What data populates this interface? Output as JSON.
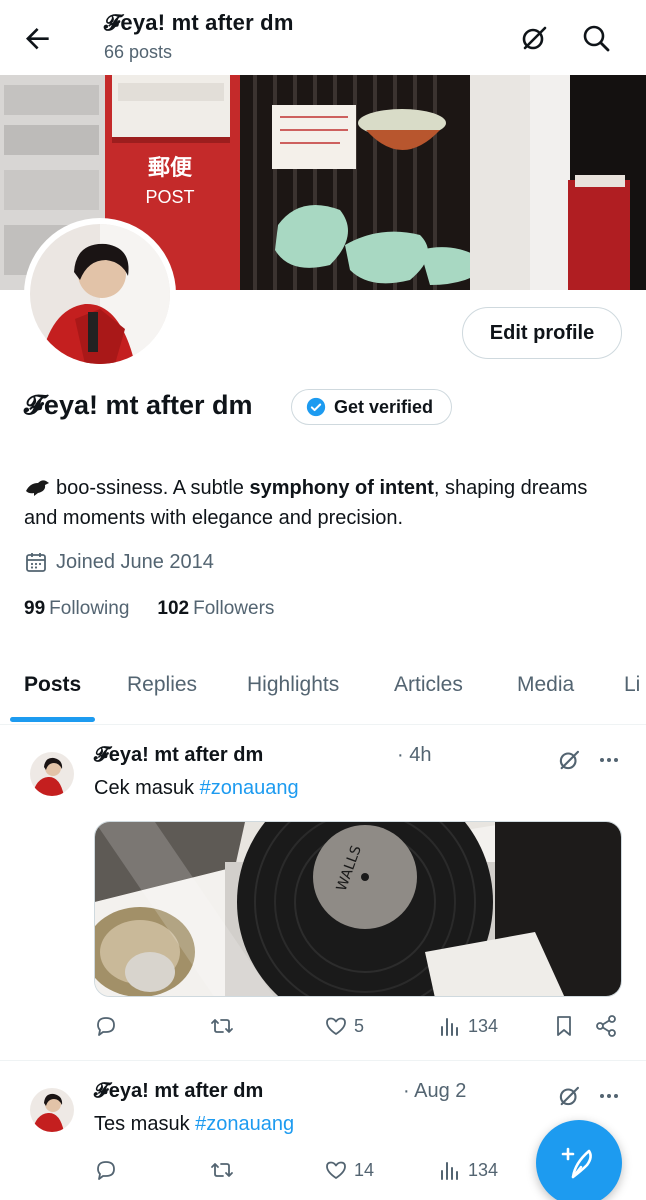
{
  "header": {
    "title": "𝓕eya! mt after dm",
    "subtitle": "66 posts"
  },
  "profile": {
    "edit_label": "Edit profile",
    "name": "𝓕eya! mt after dm",
    "verify_label": "Get verified",
    "bio_prefix": "boo-ssiness. A subtle ",
    "bio_bold": "symphony of intent",
    "bio_suffix": ", shaping dreams and moments with elegance and precision.",
    "joined": "Joined June 2014",
    "following_count": "99",
    "following_label": "Following",
    "followers_count": "102",
    "followers_label": "Followers"
  },
  "tabs": [
    {
      "label": "Posts"
    },
    {
      "label": "Replies"
    },
    {
      "label": "Highlights"
    },
    {
      "label": "Articles"
    },
    {
      "label": "Media"
    },
    {
      "label": "Li"
    }
  ],
  "posts": [
    {
      "author": "𝓕eya! mt after dm",
      "time": "· 4h",
      "text": "Cek masuk ",
      "hashtag": "#zonauang",
      "likes": "5",
      "views": "134"
    },
    {
      "author": "𝓕eya! mt after dm",
      "time": "· Aug 2",
      "text": "Tes masuk ",
      "hashtag": "#zonauang",
      "likes": "14",
      "views": "134"
    }
  ],
  "colors": {
    "accent": "#1d9bf0",
    "text": "#0f1419",
    "muted": "#536471",
    "border": "#cfd9de"
  },
  "icons": {
    "back": "arrow-left-icon",
    "grok": "grok-icon",
    "search": "search-icon",
    "verified": "verified-badge-icon",
    "calendar": "calendar-icon",
    "reply": "reply-icon",
    "repost": "repost-icon",
    "like": "heart-icon",
    "views": "views-icon",
    "bookmark": "bookmark-icon",
    "share": "share-icon",
    "compose": "compose-icon"
  }
}
